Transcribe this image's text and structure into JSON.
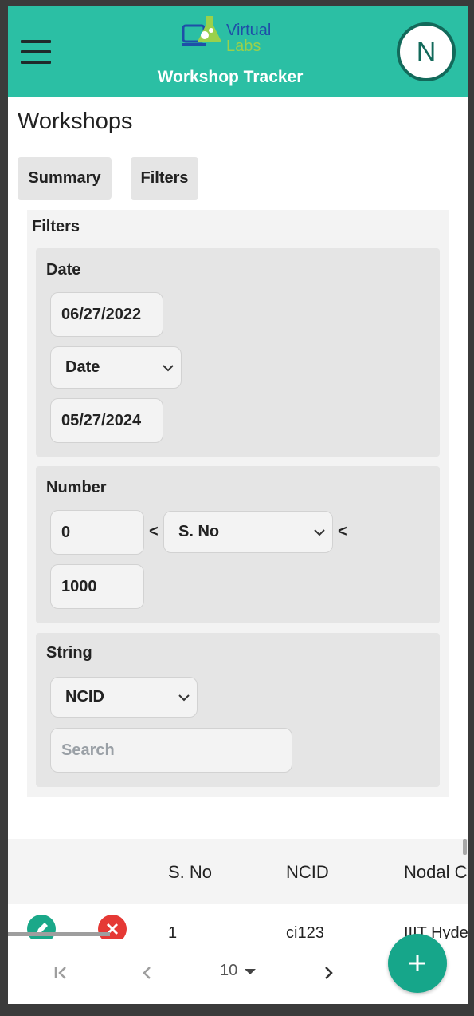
{
  "header": {
    "logo_line1": "Virtual",
    "logo_line2": "Labs",
    "title": "Workshop Tracker",
    "avatar_initial": "N"
  },
  "page": {
    "title": "Workshops",
    "tabs": [
      "Summary",
      "Filters"
    ]
  },
  "filters": {
    "title": "Filters",
    "date": {
      "label": "Date",
      "from": "06/27/2022",
      "field_select": "Date",
      "to": "05/27/2024"
    },
    "number": {
      "label": "Number",
      "min": "0",
      "lt_symbol": "<",
      "field_select": "S. No",
      "max": "1000"
    },
    "string": {
      "label": "String",
      "field_select": "NCID",
      "search_placeholder": "Search"
    }
  },
  "table": {
    "columns": [
      "S. No",
      "NCID",
      "Nodal C"
    ],
    "rows": [
      {
        "s_no": "1",
        "ncid": "ci123",
        "nodal": "IIIT Hyde"
      }
    ]
  },
  "pagination": {
    "rows_per_page": "10"
  },
  "colors": {
    "header": "#2bbfa4",
    "accent": "#16a68a",
    "danger": "#e53935"
  }
}
